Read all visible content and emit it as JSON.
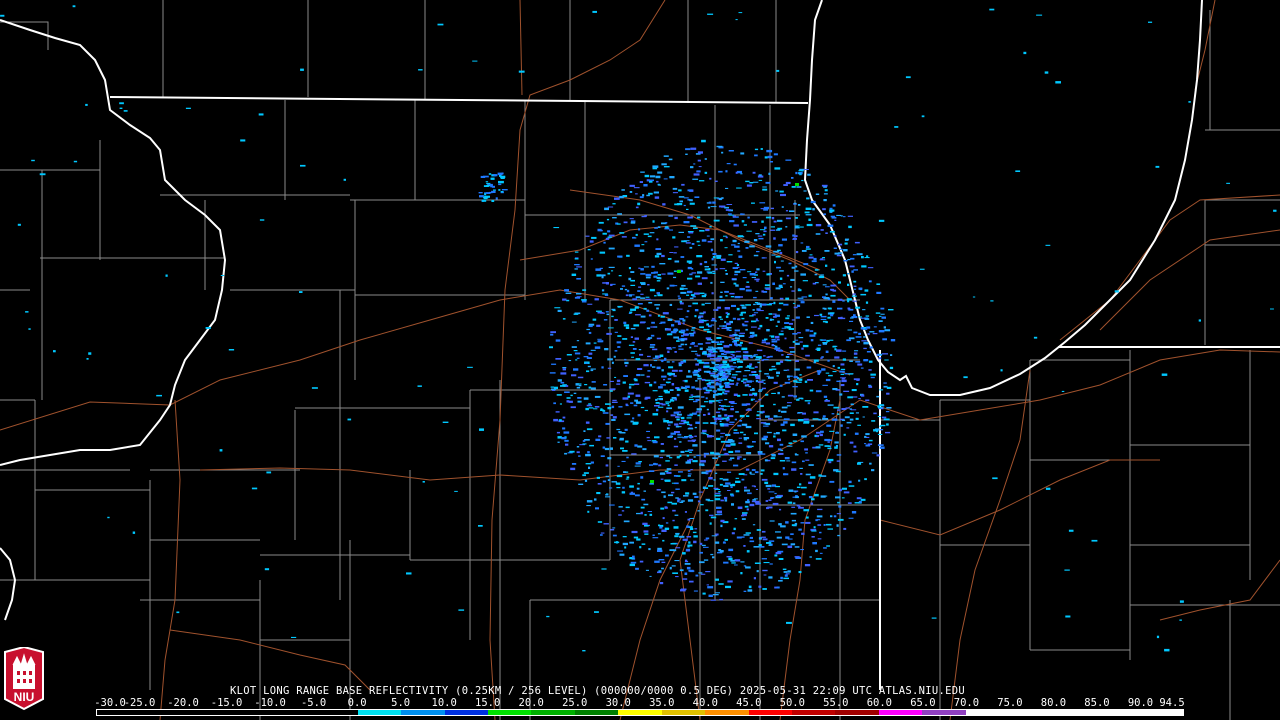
{
  "title": "KLOT LONG RANGE BASE REFLECTIVITY (0.25KM / 256 LEVEL) (000000/0000 0.5 DEG) 2025-05-31 22:09 UTC  ATLAS.NIU.EDU",
  "logo": {
    "icon": "niu-logo-icon",
    "text": "NIU"
  },
  "scale": {
    "labels": [
      "-30.0",
      "-25.0",
      "-20.0",
      "-15.0",
      "-10.0",
      "-5.0",
      "0.0",
      "5.0",
      "10.0",
      "15.0",
      "20.0",
      "25.0",
      "30.0",
      "35.0",
      "40.0",
      "45.0",
      "50.0",
      "55.0",
      "60.0",
      "65.0",
      "70.0",
      "75.0",
      "80.0",
      "85.0",
      "90.0",
      "94.5"
    ],
    "colors": [
      "#000000",
      "#000000",
      "#000000",
      "#000000",
      "#000000",
      "#000000",
      "#00e0f0",
      "#0090f0",
      "#0030e0",
      "#00e000",
      "#00b000",
      "#008000",
      "#ffff00",
      "#e0c000",
      "#ff9000",
      "#ff0000",
      "#c00000",
      "#a00000",
      "#ff00ff",
      "#9040c0",
      "#ffffff",
      "#ffffff",
      "#ffffff",
      "#ffffff",
      "#ffffff"
    ]
  },
  "colors": {
    "state_border": "#ffffff",
    "county_border": "#8a8a8a",
    "highway": "#a0522d",
    "echo_light": "#00c8ff",
    "echo_mid": "#1e78ff",
    "echo_green": "#00e000"
  }
}
